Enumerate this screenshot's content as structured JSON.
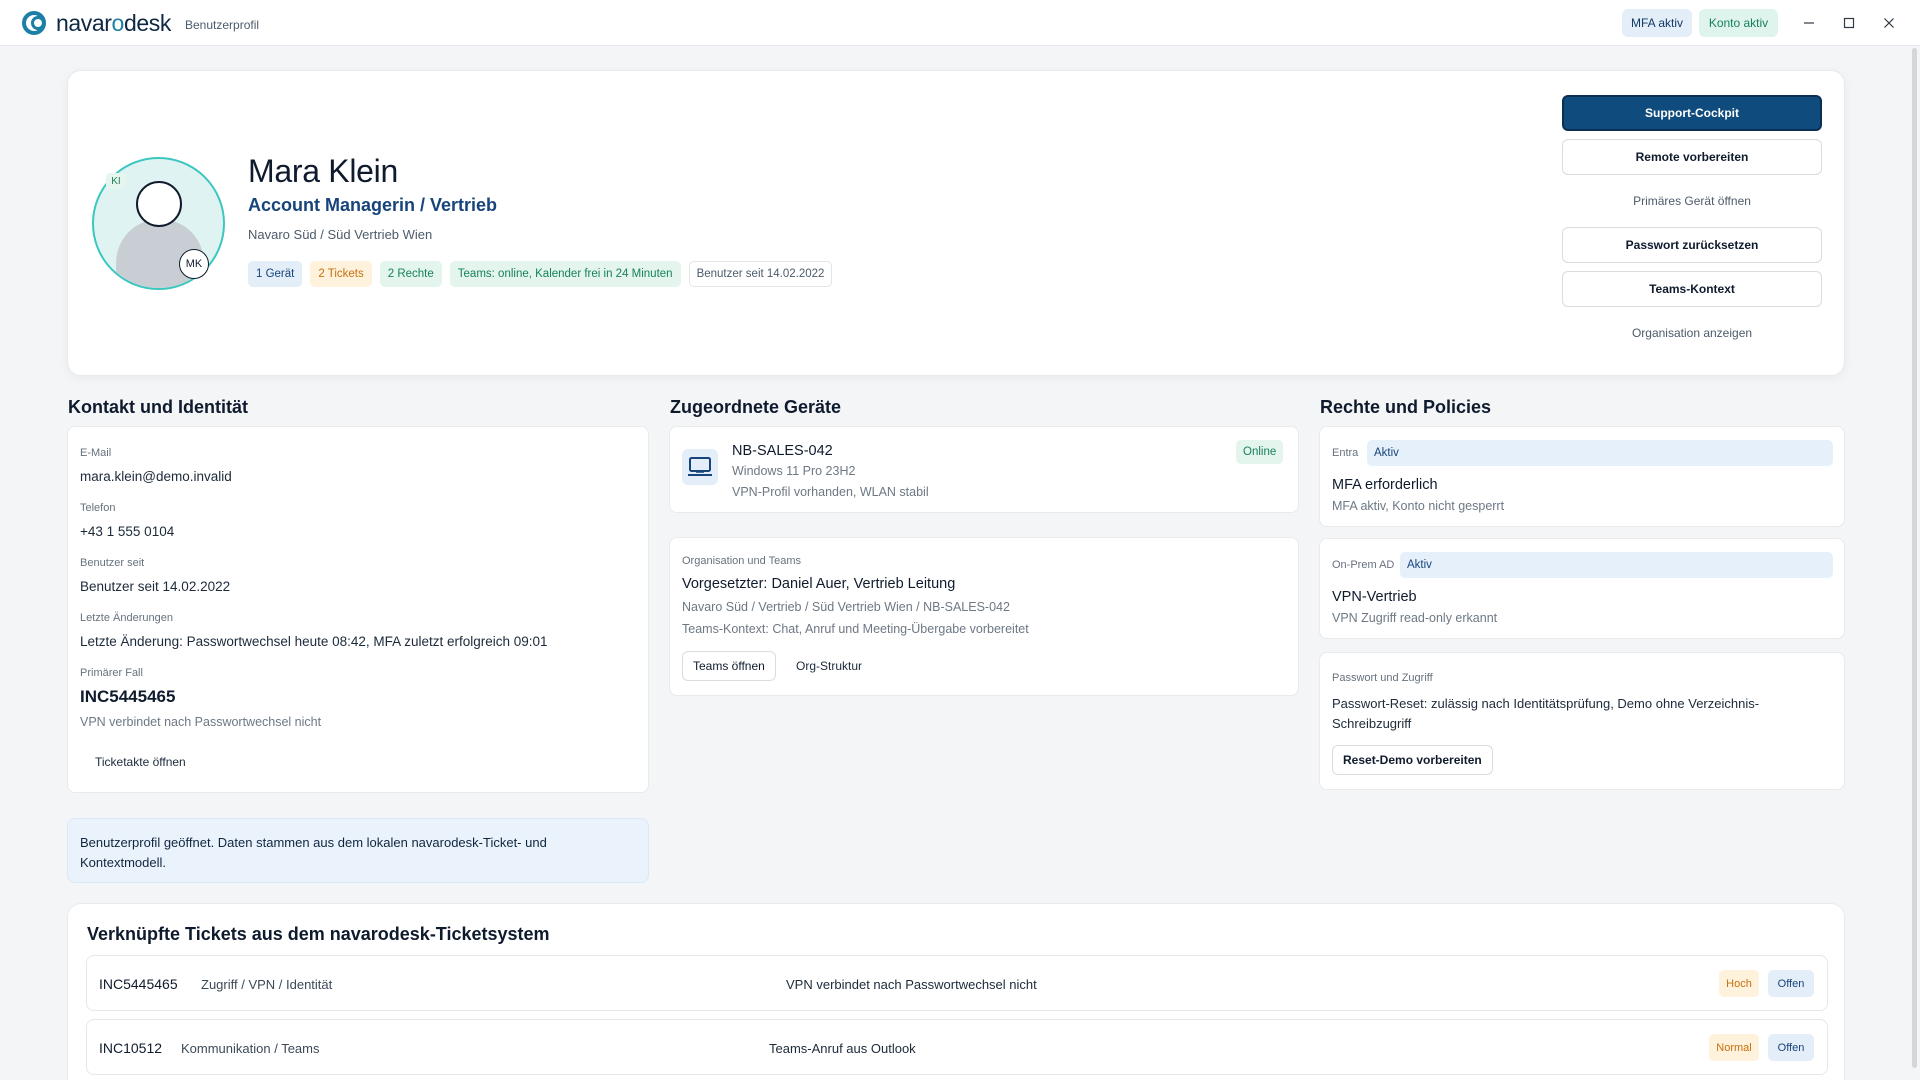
{
  "app": {
    "logo_text_a": "navar",
    "logo_text_b": "o",
    "logo_text_c": "desk",
    "breadcrumb": "Benutzerprofil",
    "status_mfa": "MFA aktiv",
    "status_konto": "Konto aktiv"
  },
  "profile": {
    "name": "Mara Klein",
    "role": "Account Managerin / Vertrieb",
    "org": "Navaro Süd / Süd Vertrieb Wien",
    "avatar_tag": "KI",
    "initials": "MK",
    "chips": [
      {
        "label": "1 Gerät",
        "tone": "blue"
      },
      {
        "label": "2 Tickets",
        "tone": "orange"
      },
      {
        "label": "2 Rechte",
        "tone": "green"
      },
      {
        "label": "Teams: online, Kalender frei in 24 Minuten",
        "tone": "green"
      },
      {
        "label": "Benutzer seit 14.02.2022",
        "tone": "plain"
      }
    ]
  },
  "actions": {
    "support_cockpit": "Support-Cockpit",
    "remote": "Remote vorbereiten",
    "primary_device": "Primäres Gerät öffnen",
    "password_reset": "Passwort zurücksetzen",
    "teams_context": "Teams-Kontext",
    "show_org": "Organisation anzeigen"
  },
  "contact": {
    "section_title": "Kontakt und Identität",
    "email_label": "E-Mail",
    "email": "mara.klein@demo.invalid",
    "phone_label": "Telefon",
    "phone": "+43 1 555 0104",
    "since_label": "Benutzer seit",
    "since": "Benutzer seit 14.02.2022",
    "changes_label": "Letzte Änderungen",
    "changes": "Letzte Änderung: Passwortwechsel heute 08:42, MFA zuletzt erfolgreich 09:01",
    "case_label": "Primärer Fall",
    "case_id": "INC5445465",
    "case_desc": "VPN verbindet nach Passwortwechsel nicht",
    "case_button": "Ticketakte öffnen"
  },
  "info_message": "Benutzerprofil geöffnet. Daten stammen aus dem lokalen navarodesk-Ticket- und Kontextmodell.",
  "devices": {
    "section_title": "Zugeordnete Geräte",
    "device_name": "NB-SALES-042",
    "device_os": "Windows 11 Pro 23H2",
    "device_note": "VPN-Profil vorhanden, WLAN stabil",
    "device_status": "Online",
    "org_label": "Organisation und Teams",
    "manager": "Vorgesetzter: Daniel Auer, Vertrieb Leitung",
    "org_path": "Navaro Süd / Vertrieb / Süd Vertrieb Wien / NB-SALES-042",
    "teams_context": "Teams-Kontext: Chat, Anruf und Meeting-Übergabe vorbereitet",
    "open_teams": "Teams öffnen",
    "org_structure": "Org-Struktur"
  },
  "policies": {
    "section_title": "Rechte und Policies",
    "items": [
      {
        "source": "Entra",
        "state": "Aktiv",
        "title": "MFA erforderlich",
        "sub": "MFA aktiv, Konto nicht gesperrt"
      },
      {
        "source": "On-Prem AD",
        "state": "Aktiv",
        "title": "VPN-Vertrieb",
        "sub": "VPN Zugriff read-only erkannt"
      }
    ],
    "password_label": "Passwort und Zugriff",
    "password_text": "Passwort-Reset: zulässig nach Identitätsprüfung, Demo ohne Verzeichnis-Schreibzugriff",
    "password_button": "Reset-Demo vorbereiten"
  },
  "tickets": {
    "section_title": "Verknüpfte Tickets aus dem navarodesk-Ticketsystem",
    "rows": [
      {
        "id": "INC5445465",
        "category": "Zugriff / VPN / Identität",
        "description": "VPN verbindet nach Passwortwechsel nicht",
        "priority": "Hoch",
        "status": "Offen"
      },
      {
        "id": "INC10512",
        "category": "Kommunikation / Teams",
        "description": "Teams-Anruf aus Outlook",
        "priority": "Normal",
        "status": "Offen"
      }
    ]
  },
  "icons": {
    "minimize": "minimize-icon",
    "maximize": "maximize-icon",
    "close": "close-icon",
    "device": "laptop-icon",
    "avatar": "user-avatar-icon"
  }
}
